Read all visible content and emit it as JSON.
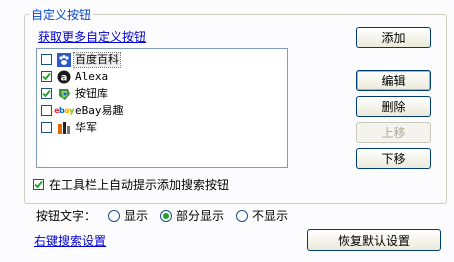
{
  "group": {
    "title": "自定义按钮"
  },
  "more_link": "获取更多自定义按钮",
  "items": [
    {
      "label": "百度百科",
      "checked": false,
      "icon": "paw-icon"
    },
    {
      "label": "Alexa",
      "checked": true,
      "icon": "alexa-icon"
    },
    {
      "label": "按钮库",
      "checked": true,
      "icon": "button-library-icon"
    },
    {
      "label": "eBay易趣",
      "checked": false,
      "icon": "ebay-icon"
    },
    {
      "label": "华军",
      "checked": false,
      "icon": "huajun-icon"
    }
  ],
  "buttons": {
    "add": "添加",
    "edit": "编辑",
    "delete": "删除",
    "move_up": "上移",
    "move_down": "下移",
    "restore": "恢复默认设置"
  },
  "auto_prompt": {
    "label": "在工具栏上自动提示添加搜索按钮",
    "checked": true
  },
  "button_text": {
    "label": "按钮文字：",
    "options": [
      "显示",
      "部分显示",
      "不显示"
    ],
    "selected": "部分显示"
  },
  "right_click_link": "右键搜索设置",
  "colors": {
    "accent": "#0046d5",
    "check": "#21a121",
    "link": "#0000cc"
  }
}
